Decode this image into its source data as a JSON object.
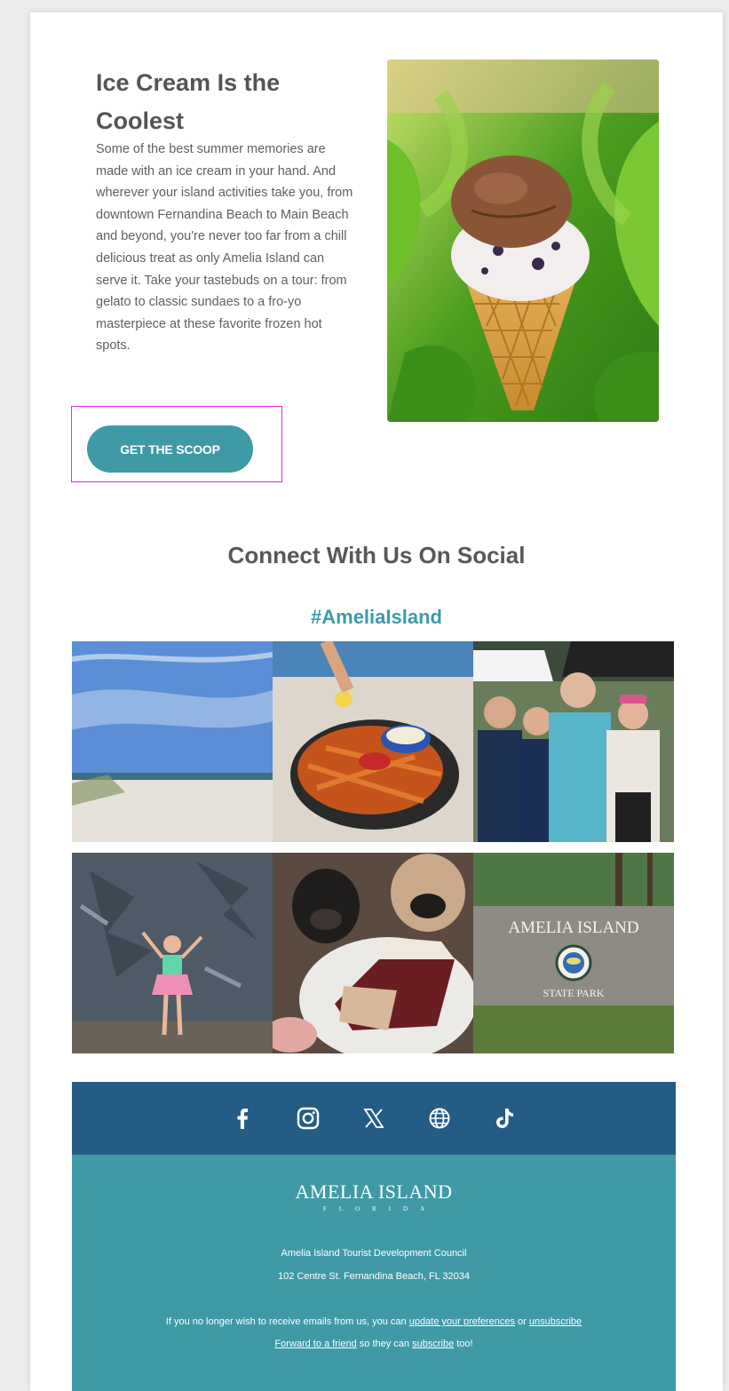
{
  "article": {
    "title": "Ice Cream Is the Coolest",
    "body": "Some of the best summer memories are made with an ice cream in your hand. And wherever your island activities take you, from downtown Fernandina Beach to Main Beach and beyond, you're never too far from a chill delicious treat as only Amelia Island can serve it. Take your tastebuds on a tour: from gelato to classic sundaes to a fro-yo masterpiece at these favorite frozen hot spots.",
    "cta_label": "GET THE SCOOP",
    "image_icon": "ice-cream-cone-photo"
  },
  "social": {
    "heading": "Connect With Us On Social",
    "hashtag": "#AmeliaIsland",
    "photos": [
      {
        "icon": "beach-photo"
      },
      {
        "icon": "shrimp-and-fries-photo"
      },
      {
        "icon": "festival-group-photo"
      },
      {
        "icon": "mural-wall-photo"
      },
      {
        "icon": "pugs-and-cake-photo"
      },
      {
        "icon": "state-park-sign-photo",
        "sign_title": "AMELIA ISLAND",
        "sign_subtitle": "STATE PARK"
      }
    ]
  },
  "footer": {
    "social_icons": [
      "facebook-icon",
      "instagram-icon",
      "x-icon",
      "website-globe-icon",
      "tiktok-icon"
    ],
    "logo_text": "AMELIA ISLAND",
    "logo_subtext": "FLORIDA",
    "org_name": "Amelia Island Tourist Development Council",
    "address": "102 Centre St. Fernandina Beach, FL 32034",
    "unsub_prefix": "If you no longer wish to receive emails from us, you can ",
    "update_prefs_link": "update your preferences",
    "unsub_or": " or ",
    "unsubscribe_link": "unsubscribe",
    "forward_link": "Forward to a friend",
    "forward_middle": " so they can ",
    "subscribe_link": "subscribe",
    "forward_suffix": " too!"
  },
  "colors": {
    "teal_accent": "#3f9aa6",
    "navy_social_bar": "#255c86",
    "highlight_box": "#e629e0"
  }
}
